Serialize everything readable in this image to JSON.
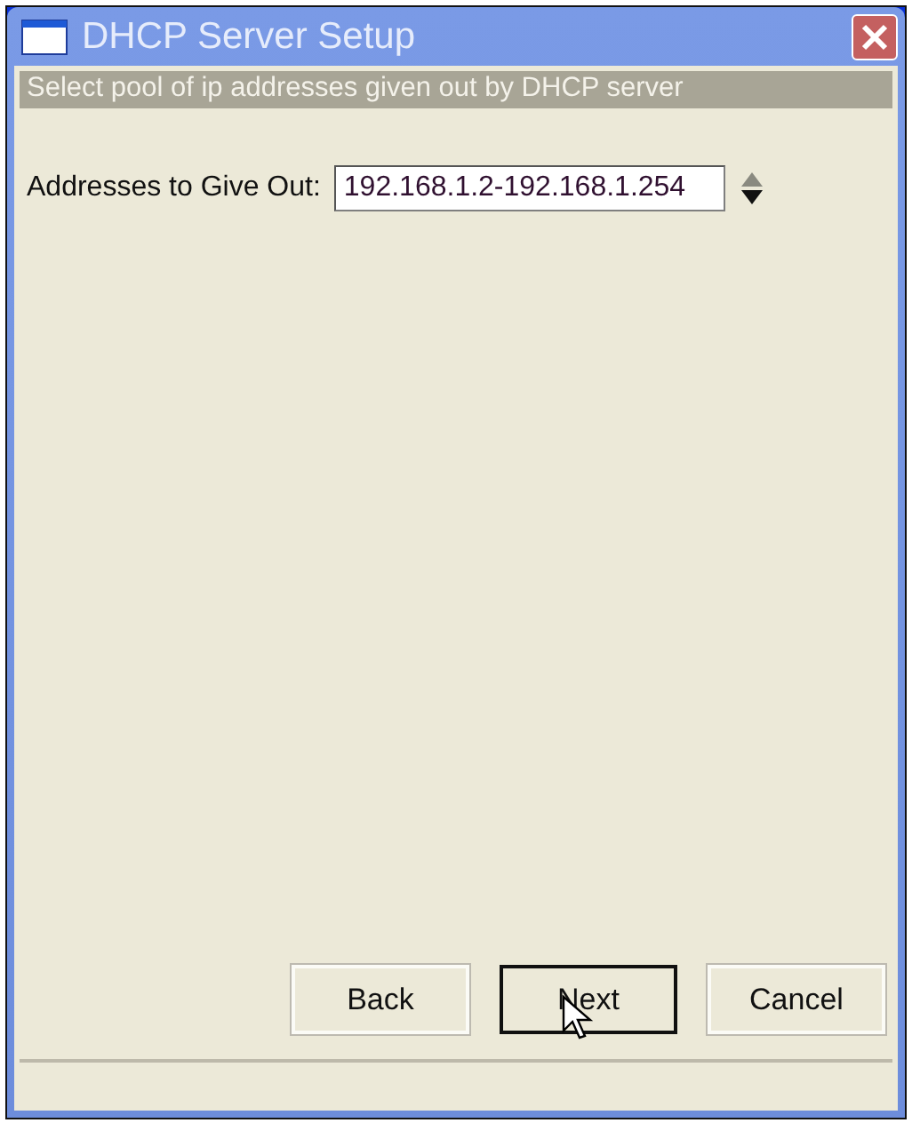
{
  "window": {
    "title": "DHCP Server Setup"
  },
  "header": "Select pool of ip addresses given out by DHCP server",
  "field": {
    "label": "Addresses to Give Out:",
    "value": "192.168.1.2-192.168.1.254"
  },
  "buttons": [
    {
      "label": "Back",
      "default": false
    },
    {
      "label": "Next",
      "default": true
    },
    {
      "label": "Cancel",
      "default": false
    }
  ]
}
